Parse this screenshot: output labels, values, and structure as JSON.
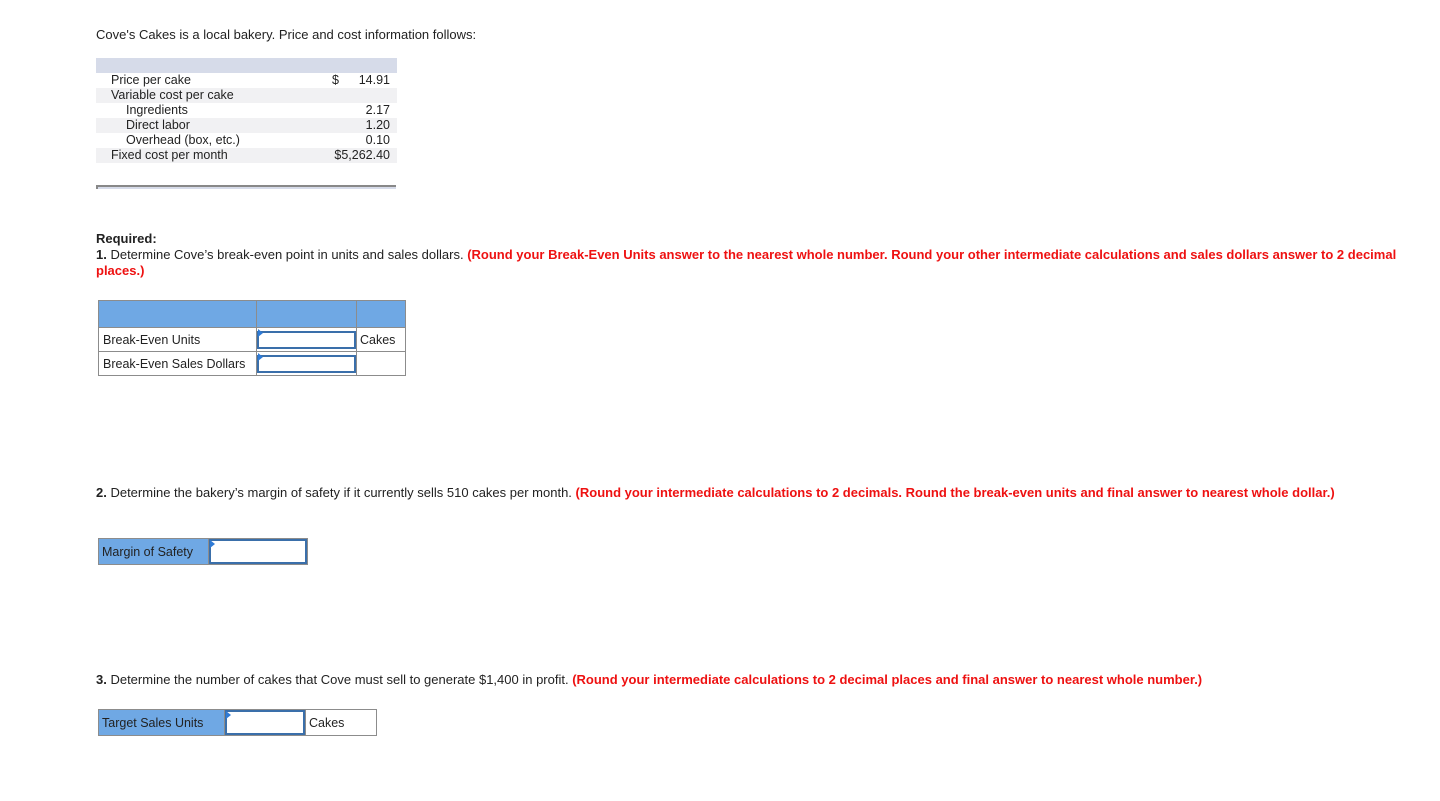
{
  "intro": "Cove's Cakes is a local bakery. Price and cost information follows:",
  "cost_table": {
    "rows": [
      {
        "label": "Price per cake",
        "currency": "$",
        "value": "14.91",
        "indent": false
      },
      {
        "label": "Variable cost per cake",
        "currency": "",
        "value": "",
        "indent": false
      },
      {
        "label": "Ingredients",
        "currency": "",
        "value": "2.17",
        "indent": true
      },
      {
        "label": "Direct labor",
        "currency": "",
        "value": "1.20",
        "indent": true
      },
      {
        "label": "Overhead (box, etc.)",
        "currency": "",
        "value": "0.10",
        "indent": true
      },
      {
        "label": "Fixed cost per month",
        "currency": "",
        "value": "$5,262.40",
        "indent": false
      }
    ]
  },
  "required": {
    "heading": "Required:",
    "q1": {
      "number": "1.",
      "text": " Determine Cove’s break-even point in units and sales dollars. ",
      "note": "(Round your Break-Even Units answer to the nearest whole number. Round your other intermediate calculations and sales dollars answer to 2 decimal places.)"
    },
    "q2": {
      "number": "2.",
      "text": " Determine the bakery’s margin of safety if it currently sells 510 cakes per month. ",
      "note": "(Round your intermediate calculations to 2 decimals. Round the break-even units and final answer to nearest whole dollar.)"
    },
    "q3": {
      "number": "3.",
      "text": " Determine the number of cakes that Cove must sell to generate $1,400 in profit. ",
      "note": "(Round your intermediate calculations to 2 decimal places and final answer to nearest whole number.)"
    }
  },
  "answers": {
    "break_even_units": {
      "label": "Break-Even Units",
      "value": "",
      "unit": "Cakes"
    },
    "break_even_sales": {
      "label": "Break-Even Sales Dollars",
      "value": "",
      "unit": ""
    },
    "margin_of_safety": {
      "label": "Margin of Safety",
      "value": ""
    },
    "target_sales_units": {
      "label": "Target Sales Units",
      "value": "",
      "unit": "Cakes"
    }
  }
}
